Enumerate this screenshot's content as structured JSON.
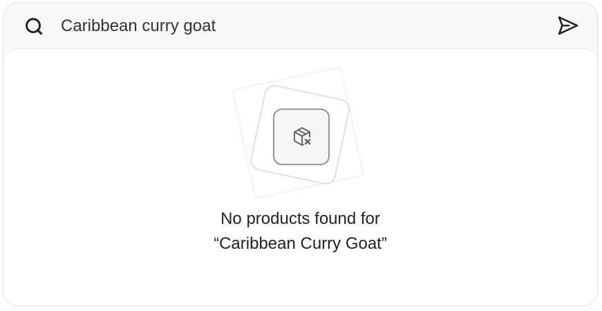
{
  "search": {
    "value": "Caribbean curry goat",
    "icon": "search-icon",
    "submit_icon": "send-icon"
  },
  "empty_state": {
    "icon": "box-remove-icon",
    "line1": "No products found for",
    "line2": "“Caribbean Curry Goat”"
  },
  "colors": {
    "header_bg": "#f7f7f7",
    "panel_bg": "#ffffff",
    "border": "#e4e4e4",
    "text": "#222222",
    "icon": "#666666"
  }
}
